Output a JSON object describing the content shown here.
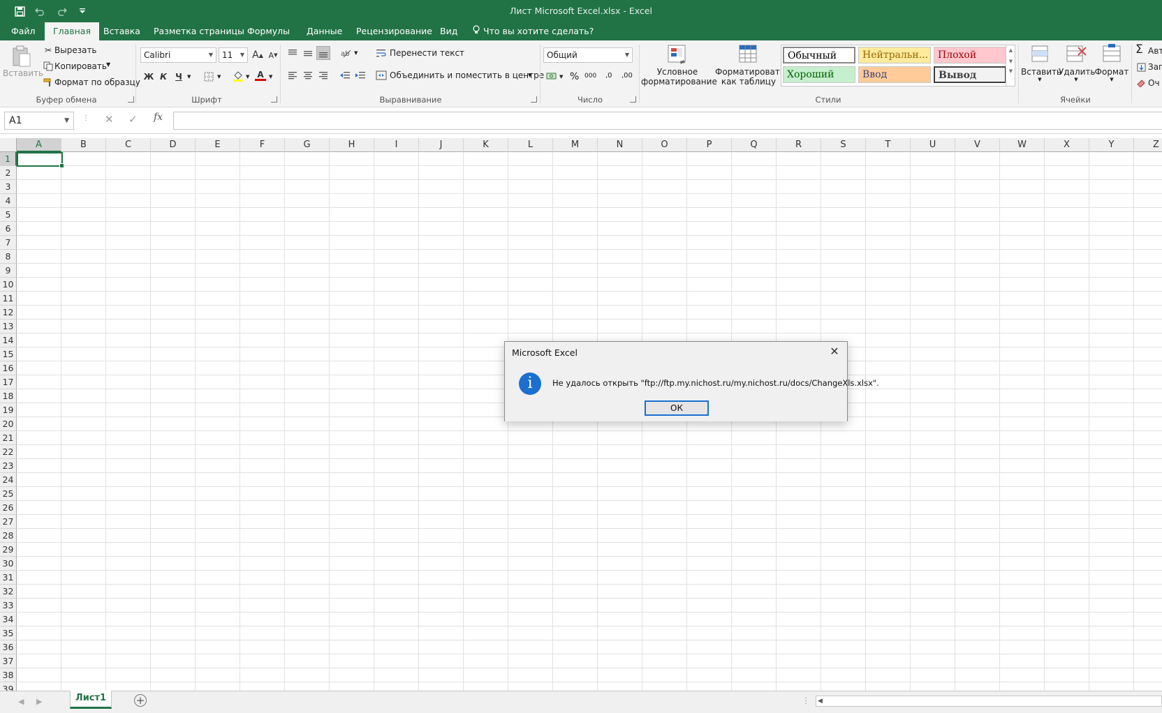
{
  "window": {
    "title": "Лист Microsoft Excel.xlsx - Excel"
  },
  "qat": {
    "icons": [
      "save-icon",
      "undo-icon",
      "redo-icon",
      "customize-icon"
    ]
  },
  "tabs": [
    {
      "label": "Файл"
    },
    {
      "label": "Главная"
    },
    {
      "label": "Вставка"
    },
    {
      "label": "Разметка страницы"
    },
    {
      "label": "Формулы"
    },
    {
      "label": "Данные"
    },
    {
      "label": "Рецензирование"
    },
    {
      "label": "Вид"
    },
    {
      "label": "Что вы хотите сделать?"
    }
  ],
  "ribbon": {
    "clipboard": {
      "paste": "Вставить",
      "cut": "Вырезать",
      "copy": "Копировать",
      "format_painter": "Формат по образцу",
      "label": "Буфер обмена"
    },
    "font": {
      "name": "Calibri",
      "size": "11",
      "bold": "Ж",
      "italic": "К",
      "underline": "Ч",
      "grow": "A",
      "shrink": "A",
      "font_color": "A",
      "label": "Шрифт"
    },
    "alignment": {
      "wrap": "Перенести текст",
      "merge": "Объединить и поместить в центре",
      "label": "Выравнивание"
    },
    "number": {
      "format": "Общий",
      "percent": "%",
      "thousands": "000",
      "inc_decimal": ",0",
      "dec_decimal": ",00",
      "label": "Число"
    },
    "styles": {
      "conditional_1": "Условное",
      "conditional_2": "форматирование",
      "as_table_1": "Форматировать",
      "as_table_2": "как таблицу",
      "cells": [
        {
          "label": "Обычный",
          "bg": "#ffffff",
          "color": "#000000"
        },
        {
          "label": "Нейтральн...",
          "bg": "#ffeb9c",
          "color": "#9c6500"
        },
        {
          "label": "Плохой",
          "bg": "#ffc7ce",
          "color": "#9c0006"
        },
        {
          "label": "Хороший",
          "bg": "#c6efce",
          "color": "#006100"
        },
        {
          "label": "Ввод",
          "bg": "#ffcc99",
          "color": "#3f3f76"
        },
        {
          "label": "Вывод",
          "bg": "#f2f2f2",
          "color": "#3f3f3f"
        }
      ],
      "label": "Стили"
    },
    "cells": {
      "insert": "Вставить",
      "delete": "Удалить",
      "format": "Формат",
      "label": "Ячейки"
    },
    "editing": {
      "autosum": "Авт",
      "fill": "Зап",
      "clear": "Оч"
    }
  },
  "formula_bar": {
    "name_box": "A1",
    "fx": "fx",
    "value": ""
  },
  "grid": {
    "columns": [
      "A",
      "B",
      "C",
      "D",
      "E",
      "F",
      "G",
      "H",
      "I",
      "J",
      "K",
      "L",
      "M",
      "N",
      "O",
      "P",
      "Q",
      "R",
      "S",
      "T",
      "U",
      "V",
      "W",
      "X",
      "Y",
      "Z"
    ],
    "rows": [
      "1",
      "2",
      "3",
      "4",
      "5",
      "6",
      "7",
      "8",
      "9",
      "10",
      "11",
      "12",
      "13",
      "14",
      "15",
      "16",
      "17",
      "18",
      "19",
      "20",
      "21",
      "22",
      "23",
      "24",
      "25",
      "26",
      "27",
      "28",
      "29",
      "30",
      "31",
      "32",
      "33",
      "34",
      "35",
      "36",
      "37",
      "38",
      "39"
    ],
    "active_cell": "A1"
  },
  "sheets": {
    "tabs": [
      "Лист1"
    ]
  },
  "dialog": {
    "title": "Microsoft Excel",
    "message": "Не удалось открыть \"ftp://ftp.my.nichost.ru/my.nichost.ru/docs/ChangeXls.xlsx\".",
    "ok": "ОК"
  },
  "colors": {
    "accent": "#217346",
    "info": "#1a6fd0"
  }
}
